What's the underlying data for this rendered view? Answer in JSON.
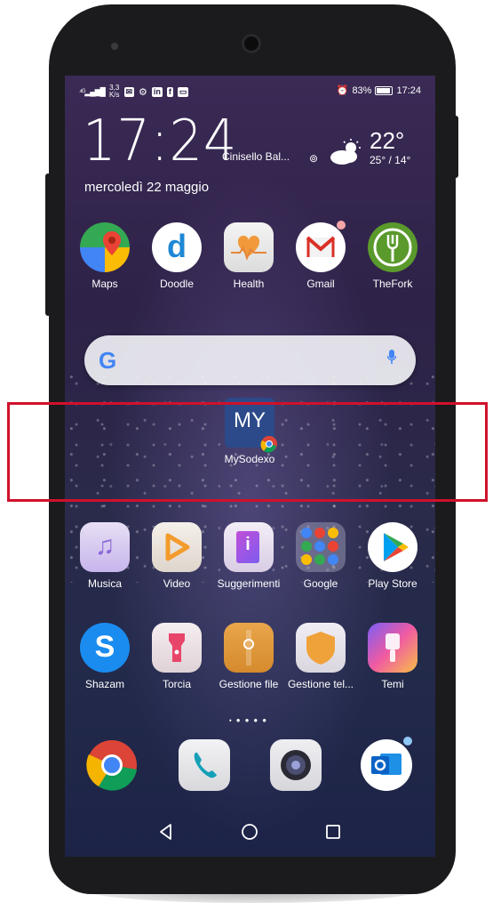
{
  "status_bar": {
    "speed_top": "3,3",
    "speed_unit": "K/s",
    "battery": "83%",
    "time": "17:24"
  },
  "clock_widget": {
    "time": "17:24",
    "city": "Cinisello Bal...",
    "temperature": "22°",
    "range": "25° / 14°",
    "date": "mercoledì 22 maggio"
  },
  "top_apps": [
    {
      "label": "Maps"
    },
    {
      "label": "Doodle"
    },
    {
      "label": "Health"
    },
    {
      "label": "Gmail"
    },
    {
      "label": "TheFork"
    }
  ],
  "folder_app": {
    "icon_text": "MY",
    "label": "MySodexo"
  },
  "row2_apps": [
    {
      "label": "Musica"
    },
    {
      "label": "Video"
    },
    {
      "label": "Suggerimenti"
    },
    {
      "label": "Google"
    },
    {
      "label": "Play Store"
    }
  ],
  "row3_apps": [
    {
      "label": "Shazam"
    },
    {
      "label": "Torcia"
    },
    {
      "label": "Gestione file"
    },
    {
      "label": "Gestione tel..."
    },
    {
      "label": "Temi"
    }
  ],
  "dock": [
    "chrome-icon",
    "phone-icon",
    "camera-icon",
    "outlook-icon"
  ],
  "colors": {
    "highlight": "#d0112b",
    "mysodexo_bg": "#2c4a8a",
    "google_blue": "#4285f4"
  }
}
